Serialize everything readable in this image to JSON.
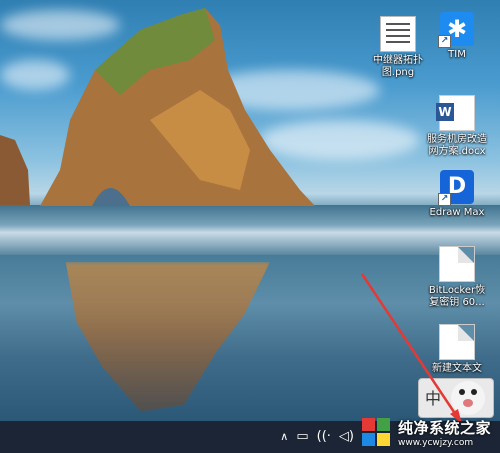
{
  "desktop_icons": [
    {
      "name": "png-image-icon",
      "label_line1": "中继器拓扑",
      "label_line2": "图.png"
    },
    {
      "name": "tim-app-icon",
      "label_line1": "TIM",
      "label_line2": "",
      "glyph": "✱"
    },
    {
      "name": "word-doc-icon",
      "label_line1": "服务机房改造",
      "label_line2": "网方案.docx",
      "glyph": "W"
    },
    {
      "name": "edraw-max-icon",
      "label_line1": "Edraw Max",
      "label_line2": "",
      "glyph": "D"
    },
    {
      "name": "bitlocker-file-icon",
      "label_line1": "BitLocker恢",
      "label_line2": "复密钥 60..."
    },
    {
      "name": "new-text-file-icon",
      "label_line1": "新建文本文",
      "label_line2": ""
    }
  ],
  "ime": {
    "mode": "中"
  },
  "tray": {
    "expand": "∧",
    "battery": "▭",
    "network": "((·",
    "volume": "◁)"
  },
  "watermark": {
    "title": "纯净系统之家",
    "url": "www.ycwjzy.com"
  },
  "colors": {
    "taskbar": "#1b2535",
    "arrow": "#e53935",
    "accent": "#1e8bf0"
  }
}
